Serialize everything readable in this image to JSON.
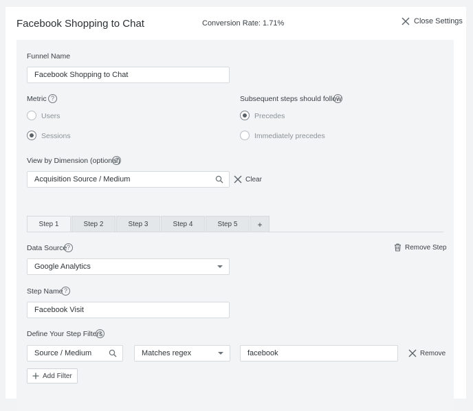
{
  "header": {
    "title": "Facebook Shopping to Chat",
    "conversion_rate": "Conversion Rate: 1.71%",
    "close_label": "Close Settings"
  },
  "funnel": {
    "name_label": "Funnel Name",
    "name_value": "Facebook Shopping to Chat"
  },
  "metric": {
    "label": "Metric",
    "options": [
      "Users",
      "Sessions"
    ],
    "selected": "Sessions"
  },
  "subsequent": {
    "label": "Subsequent steps should follow",
    "options": [
      "Precedes",
      "Immediately precedes"
    ],
    "selected": "Precedes"
  },
  "dimension": {
    "label": "View by Dimension (optional)",
    "value": "Acquisition Source / Medium",
    "clear_label": "Clear"
  },
  "tabs": [
    "Step 1",
    "Step 2",
    "Step 3",
    "Step 4",
    "Step 5",
    "+"
  ],
  "step": {
    "data_source_label": "Data Source",
    "data_source_value": "Google Analytics",
    "remove_step_label": "Remove Step",
    "step_name_label": "Step Name",
    "step_name_value": "Facebook Visit",
    "filters_label": "Define Your Step Filters",
    "filter": {
      "field": "Source / Medium",
      "operator": "Matches regex",
      "value": "facebook",
      "remove_label": "Remove"
    },
    "add_filter_label": "Add Filter"
  },
  "help_glyph": "?"
}
